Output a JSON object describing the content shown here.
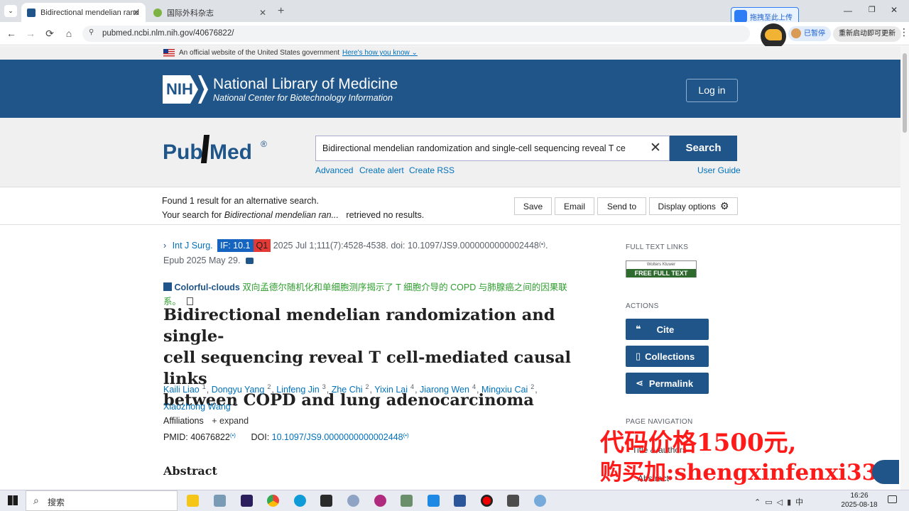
{
  "browser": {
    "tabs": [
      {
        "title": "Bidirectional mendelian rand",
        "active": true
      },
      {
        "title": "国际外科杂志",
        "active": false
      }
    ],
    "url": "pubmed.ncbi.nlm.nih.gov/40676822/",
    "upload_badge": "拖拽至此上传",
    "paused_label": "已暂停",
    "restart_label": "重新启动即可更新"
  },
  "gov_banner": {
    "text": "An official website of the United States government",
    "link": "Here's how you know"
  },
  "nih": {
    "logo": "NIH",
    "title": "National Library of Medicine",
    "subtitle": "National Center for Biotechnology Information",
    "login": "Log in"
  },
  "pubmed": {
    "logo_pub": "Pub",
    "logo_med": "Med",
    "logo_reg": "®",
    "search_value": "Bidirectional mendelian randomization and single-cell sequencing reveal T ce",
    "search_button": "Search",
    "links": [
      "Advanced",
      "Create alert",
      "Create RSS"
    ],
    "user_guide": "User Guide"
  },
  "results_bar": {
    "found": "Found 1 result for an alternative search.",
    "your_search_prefix": "Your search for ",
    "your_search_query": "Bidirectional mendelian ran...",
    "your_search_suffix": "retrieved no results.",
    "buttons": [
      "Save",
      "Email",
      "Send to",
      "Display options"
    ]
  },
  "article": {
    "journal": "Int J Surg.",
    "if_badge": "IF: 10.1",
    "quartile": "Q1",
    "citation": "2025 Jul 1;111(7):4528-4538. doi: 10.1097/JS9.0000000000002448",
    "epub": "Epub 2025 May 29.",
    "translation_brand": "Colorful-clouds",
    "translation_line1": "双向孟德尔随机化和单细胞测序揭示了 T 细胞介导的 COPD 与肺腺癌之间的因果联",
    "translation_line2": "系。",
    "title_lines": [
      "Bidirectional mendelian randomization and single-",
      "cell sequencing reveal T cell-mediated causal links",
      "between COPD and lung adenocarcinoma"
    ],
    "authors_line1": [
      {
        "name": "Kaili Liao",
        "sup": "1"
      },
      {
        "name": "Dongyu Yang",
        "sup": "2"
      },
      {
        "name": "Linfeng Jin",
        "sup": "3"
      },
      {
        "name": "Zhe Chi",
        "sup": "2"
      },
      {
        "name": "Yixin Lai",
        "sup": "4"
      },
      {
        "name": "Jiarong Wen",
        "sup": "4"
      },
      {
        "name": "Mingxiu Cai",
        "sup": "2"
      }
    ],
    "authors_line2": [
      {
        "name": "Xiaozhong Wang",
        "sup": "1"
      }
    ],
    "affiliations": "Affiliations",
    "expand": "expand",
    "pmid_label": "PMID:",
    "pmid": "40676822",
    "doi_label": "DOI:",
    "doi": "10.1097/JS9.0000000000002448",
    "abstract": "Abstract"
  },
  "sidebar": {
    "full_text_heading": "FULL TEXT LINKS",
    "fulltext_brand": "Wolters Kluwer",
    "fulltext_label": "FREE FULL TEXT",
    "actions_heading": "ACTIONS",
    "actions": [
      "Cite",
      "Collections",
      "Permalink"
    ],
    "page_nav_heading": "PAGE NAVIGATION",
    "nav_items": [
      "Title & authors",
      "Abstract"
    ]
  },
  "overlay": {
    "line1": "代码价格1500元,",
    "line2": "购买加:shengxinfenxi333",
    "color": "#ff1a1a"
  },
  "taskbar": {
    "search_label": "搜索",
    "time": "16:26",
    "date": "2025-08-18",
    "ime": "中"
  },
  "colors": {
    "nih_blue": "#20558a",
    "link": "#0071bc",
    "if_badge": "#1565c0",
    "q1": "#e53935",
    "translation": "#2e9e2e"
  }
}
